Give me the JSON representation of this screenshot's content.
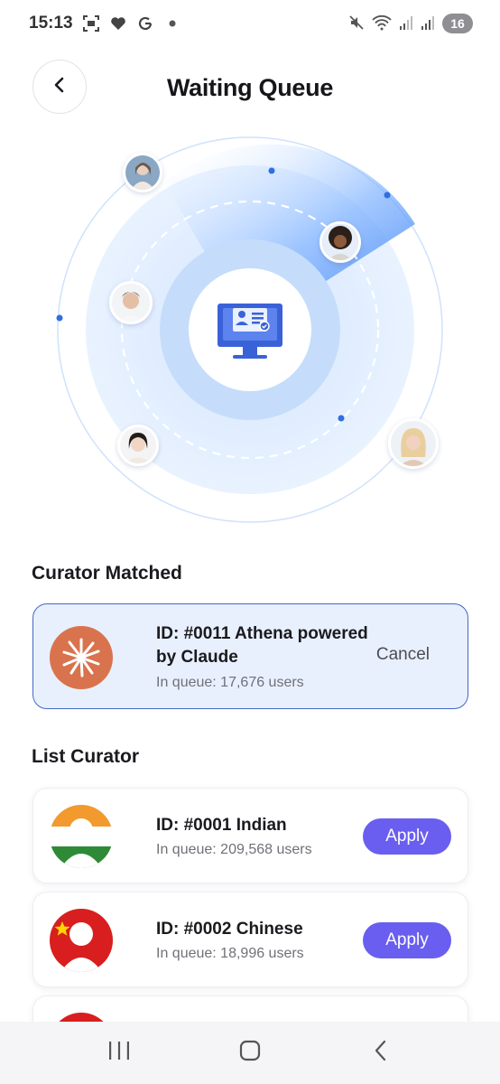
{
  "status_bar": {
    "time": "15:13",
    "battery": "16",
    "icons": [
      "screenshot-icon",
      "heart-icon",
      "google-icon",
      "dot-icon",
      "mute-icon",
      "wifi-icon",
      "signal-icon",
      "signal-icon-2"
    ]
  },
  "header": {
    "title": "Waiting Queue",
    "back_icon": "chevron-left-icon"
  },
  "radar": {
    "center_icon": "monitor-profile-icon",
    "accent_color": "#3f7ff0",
    "avatars": [
      "avatar-user-1",
      "avatar-user-2",
      "avatar-user-3",
      "avatar-user-4",
      "avatar-user-5"
    ]
  },
  "matched": {
    "section_title": "Curator Matched",
    "title_line1": "ID: #0011 Athena powered",
    "title_line2": "by Claude",
    "queue": "In queue: 17,676 users",
    "cancel_label": "Cancel",
    "logo_color": "#d9734e"
  },
  "list": {
    "section_title": "List Curator",
    "items": [
      {
        "title": "ID: #0001 Indian",
        "queue": "In queue: 209,568 users",
        "apply_label": "Apply",
        "flag": "india-flag-icon"
      },
      {
        "title": "ID: #0002 Chinese",
        "queue": "In queue: 18,996 users",
        "apply_label": "Apply",
        "flag": "china-flag-icon"
      }
    ]
  },
  "nav": {
    "recents_icon": "recents-icon",
    "home_icon": "home-icon",
    "back_icon": "back-icon"
  },
  "colors": {
    "apply_button": "#6a5ef0",
    "matched_border": "#4468c8",
    "matched_bg": "#e8f0fd"
  }
}
